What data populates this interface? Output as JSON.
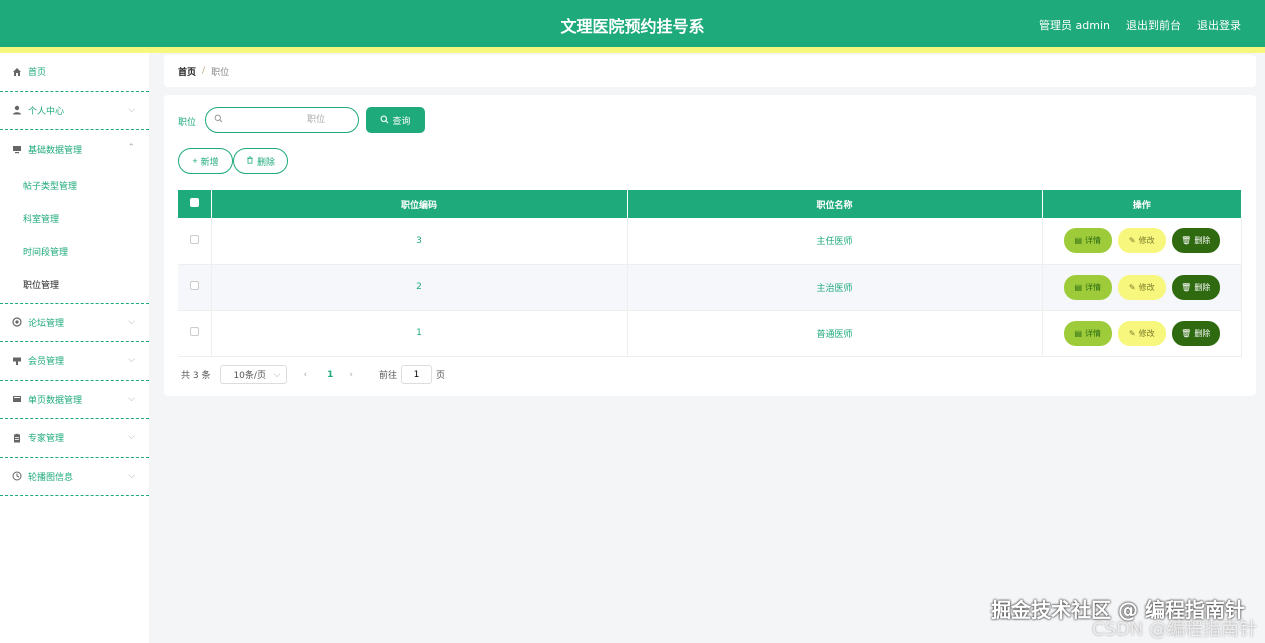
{
  "header": {
    "title": "文理医院预约挂号系",
    "admin_label": "管理员 admin",
    "front_label": "退出到前台",
    "logout_label": "退出登录"
  },
  "sidebar": {
    "items": [
      {
        "label": "首页",
        "icon": "home-icon"
      },
      {
        "label": "个人中心",
        "icon": "user-icon"
      },
      {
        "label": "基础数据管理",
        "icon": "data-icon"
      },
      {
        "label": "论坛管理",
        "icon": "forum-icon"
      },
      {
        "label": "会员管理",
        "icon": "member-icon"
      },
      {
        "label": "单页数据管理",
        "icon": "page-icon"
      },
      {
        "label": "专家管理",
        "icon": "expert-icon"
      },
      {
        "label": "轮播图信息",
        "icon": "clock-icon"
      }
    ],
    "subitems": [
      {
        "label": "帖子类型管理"
      },
      {
        "label": "科室管理"
      },
      {
        "label": "时间段管理"
      },
      {
        "label": "职位管理"
      }
    ]
  },
  "breadcrumb": {
    "home": "首页",
    "sep": "/",
    "current": "职位"
  },
  "search": {
    "label": "职位",
    "placeholder": "职位",
    "query_label": "查询"
  },
  "actions": {
    "add_label": "新增",
    "delete_label": "删除"
  },
  "table": {
    "headers": [
      "职位编码",
      "职位名称",
      "操作"
    ],
    "rows": [
      {
        "code": "3",
        "name": "主任医师"
      },
      {
        "code": "2",
        "name": "主治医师"
      },
      {
        "code": "1",
        "name": "普通医师"
      }
    ],
    "ops": {
      "detail": "详情",
      "edit": "修改",
      "delete": "删除"
    }
  },
  "pager": {
    "total": "共 3 条",
    "size": "10条/页",
    "page": "1",
    "goto_prefix": "前往",
    "goto_value": "1",
    "goto_suffix": "页"
  },
  "watermark": {
    "text": "掘金技术社区 @ 编程指南针",
    "text2": "CSDN @编程指南针"
  },
  "colors": {
    "primary": "#1eaa7a",
    "stripe": "#f6f77c",
    "detail": "#9ecb3a",
    "edit": "#f6f77c",
    "delete": "#2f6a10"
  }
}
